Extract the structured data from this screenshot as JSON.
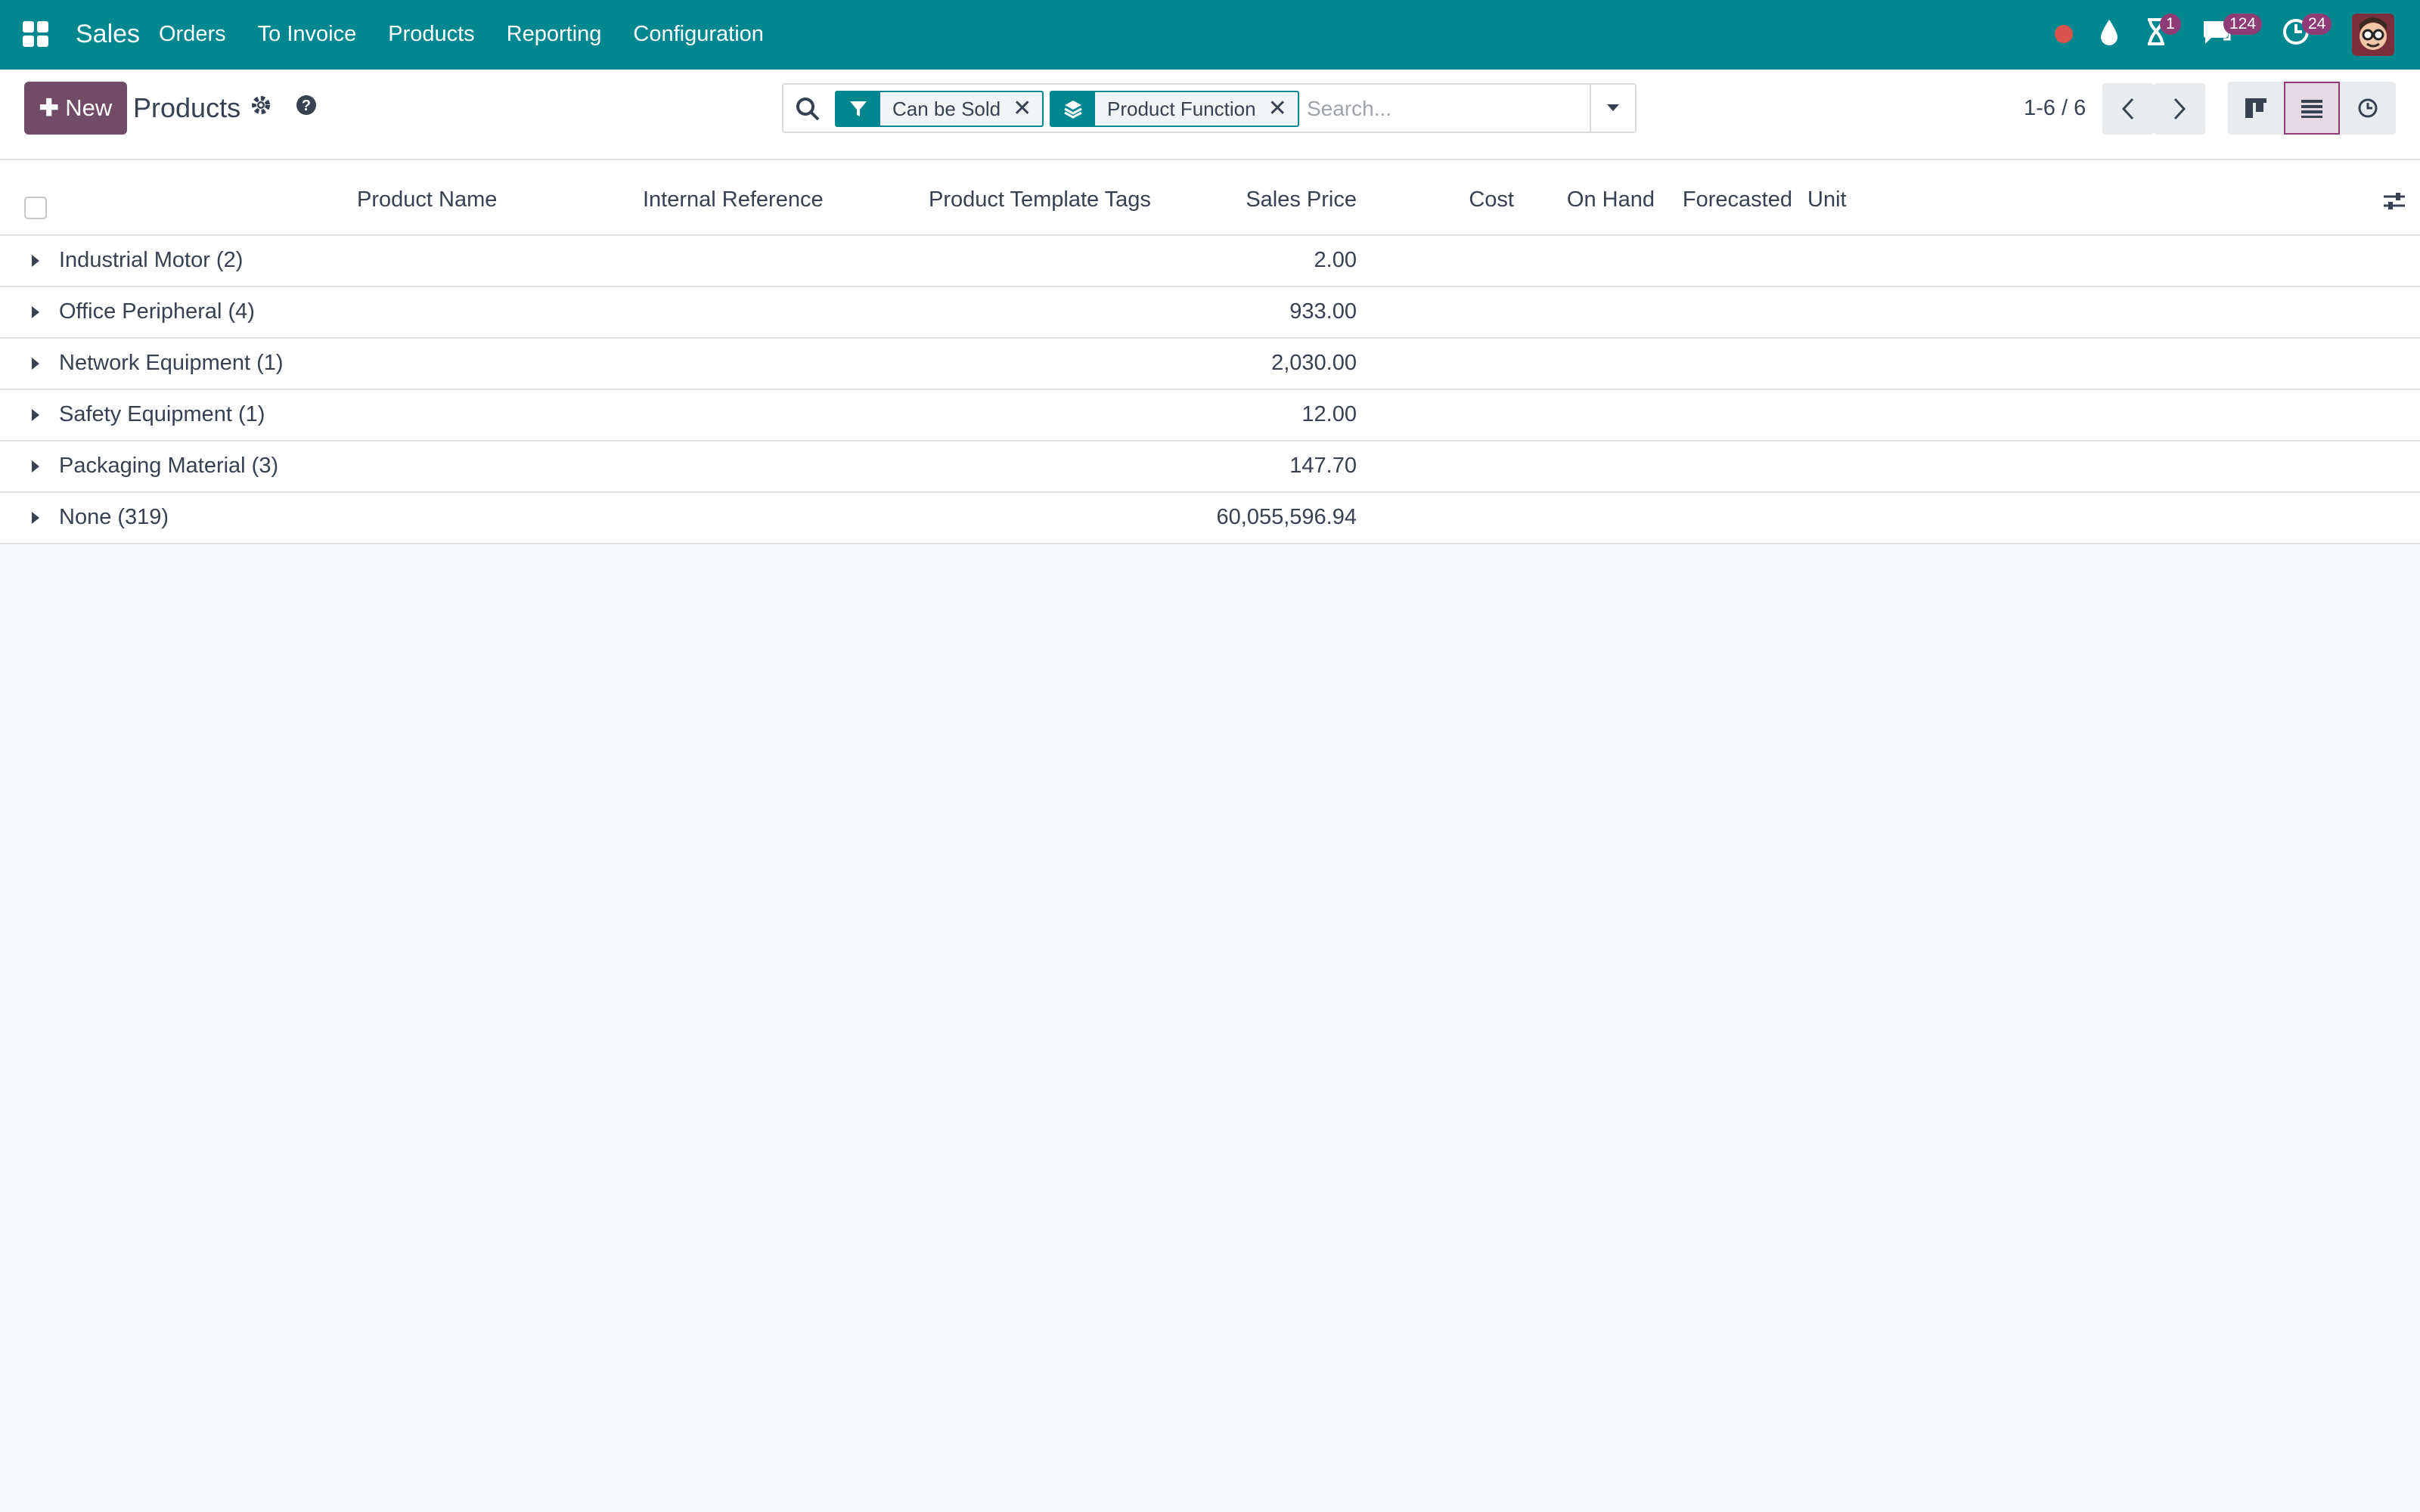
{
  "navbar": {
    "brand": "Sales",
    "menu": [
      "Orders",
      "To Invoice",
      "Products",
      "Reporting",
      "Configuration"
    ],
    "systray": {
      "activity_badge": "1",
      "messages_badge": "124",
      "updates_badge": "24"
    }
  },
  "control_panel": {
    "new_label": "New",
    "title": "Products",
    "search": {
      "facets": [
        {
          "label": "Can be Sold",
          "icon": "filter-icon"
        },
        {
          "label": "Product Function",
          "icon": "layers-icon"
        }
      ],
      "placeholder": "Search..."
    },
    "pager": "1-6 / 6",
    "views": [
      "kanban",
      "list",
      "activity"
    ],
    "active_view": "list"
  },
  "list": {
    "columns": [
      "Product Name",
      "Internal Reference",
      "Product Template Tags",
      "Sales Price",
      "Cost",
      "On Hand",
      "Forecasted",
      "Unit"
    ],
    "groups": [
      {
        "label": "Industrial Motor (2)",
        "sales_price": "2.00"
      },
      {
        "label": "Office Peripheral (4)",
        "sales_price": "933.00"
      },
      {
        "label": "Network Equipment (1)",
        "sales_price": "2,030.00"
      },
      {
        "label": "Safety Equipment (1)",
        "sales_price": "12.00"
      },
      {
        "label": "Packaging Material (3)",
        "sales_price": "147.70"
      },
      {
        "label": "None (319)",
        "sales_price": "60,055,596.94"
      }
    ]
  },
  "colors": {
    "navbar": "#00878f",
    "primary": "#714b67",
    "badge": "#8f3b76",
    "record_dot": "#d9534f"
  }
}
